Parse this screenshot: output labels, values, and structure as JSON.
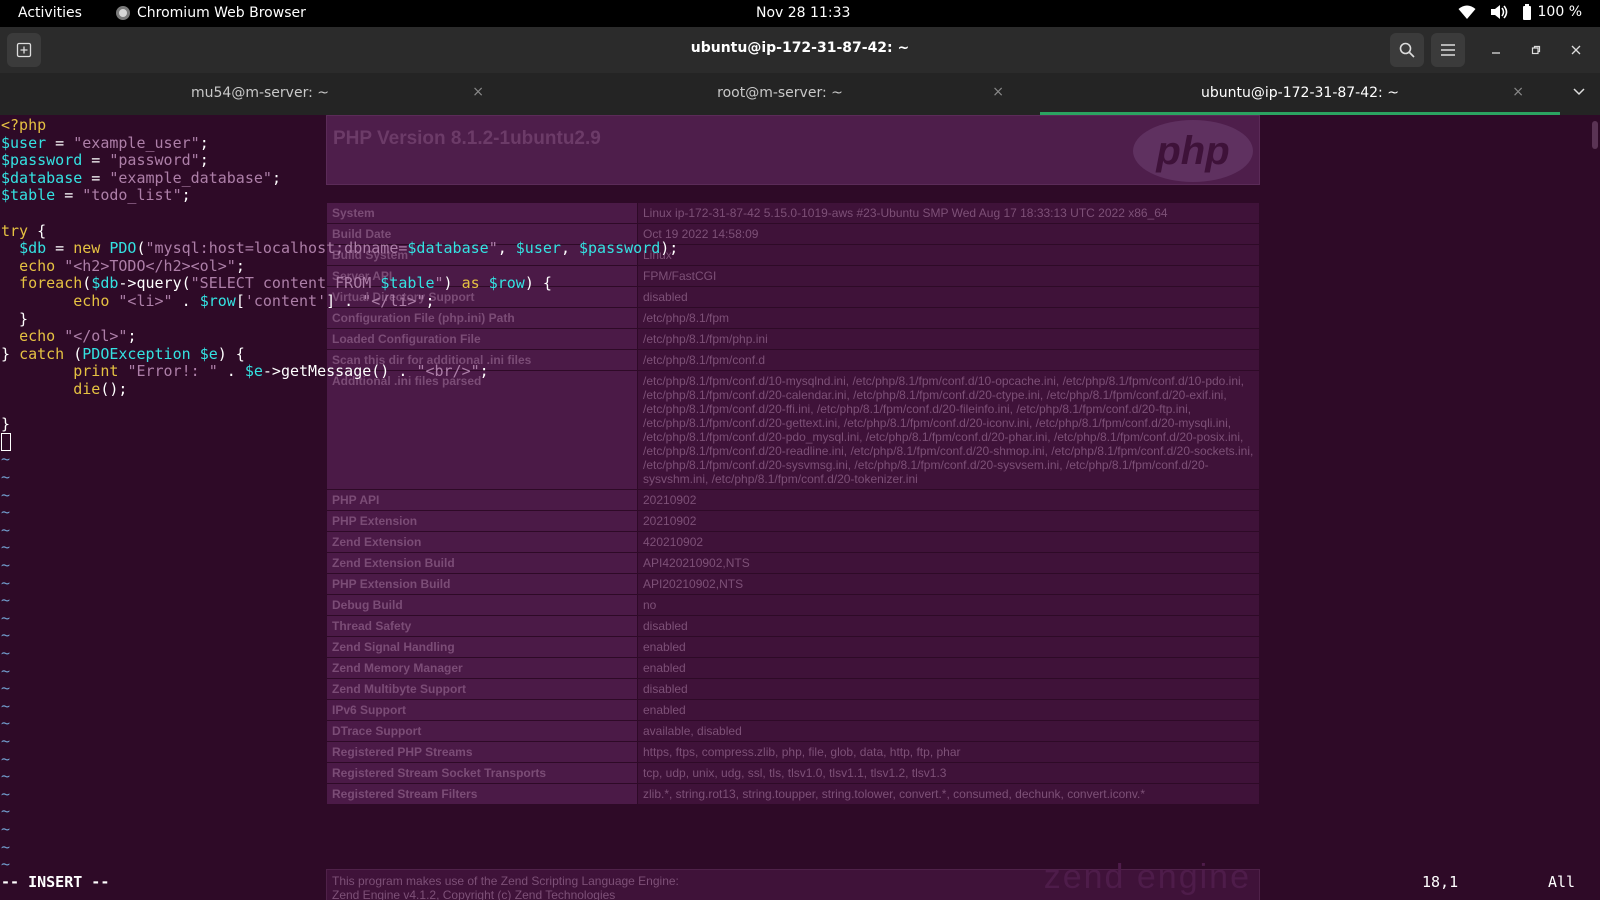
{
  "topbar": {
    "activities": "Activities",
    "app_name": "Chromium Web Browser",
    "clock": "Nov 28  11:33",
    "battery": "100 %",
    "icons": [
      "wifi-icon",
      "volume-icon",
      "battery-icon"
    ]
  },
  "window": {
    "title": "ubuntu@ip-172-31-87-42: ~"
  },
  "tabs": [
    {
      "label": "mu54@m-server: ~",
      "active": false
    },
    {
      "label": "root@m-server: ~",
      "active": false
    },
    {
      "label": "ubuntu@ip-172-31-87-42: ~",
      "active": true
    }
  ],
  "tabs_close_glyph": "×",
  "phpinfo": {
    "version": "PHP Version 8.1.2-1ubuntu2.9",
    "logo": "php",
    "rows": [
      {
        "k": "System",
        "v": "Linux ip-172-31-87-42 5.15.0-1019-aws #23-Ubuntu SMP Wed Aug 17 18:33:13 UTC 2022 x86_64"
      },
      {
        "k": "Build Date",
        "v": "Oct 19 2022 14:58:09"
      },
      {
        "k": "Build System",
        "v": "Linux"
      },
      {
        "k": "Server API",
        "v": "FPM/FastCGI"
      },
      {
        "k": "Virtual Directory Support",
        "v": "disabled"
      },
      {
        "k": "Configuration File (php.ini) Path",
        "v": "/etc/php/8.1/fpm"
      },
      {
        "k": "Loaded Configuration File",
        "v": "/etc/php/8.1/fpm/php.ini"
      },
      {
        "k": "Scan this dir for additional .ini files",
        "v": "/etc/php/8.1/fpm/conf.d"
      },
      {
        "k": "Additional .ini files parsed",
        "v": "/etc/php/8.1/fpm/conf.d/10-mysqlnd.ini, /etc/php/8.1/fpm/conf.d/10-opcache.ini, /etc/php/8.1/fpm/conf.d/10-pdo.ini, /etc/php/8.1/fpm/conf.d/20-calendar.ini, /etc/php/8.1/fpm/conf.d/20-ctype.ini, /etc/php/8.1/fpm/conf.d/20-exif.ini, /etc/php/8.1/fpm/conf.d/20-ffi.ini, /etc/php/8.1/fpm/conf.d/20-fileinfo.ini, /etc/php/8.1/fpm/conf.d/20-ftp.ini, /etc/php/8.1/fpm/conf.d/20-gettext.ini, /etc/php/8.1/fpm/conf.d/20-iconv.ini, /etc/php/8.1/fpm/conf.d/20-mysqli.ini, /etc/php/8.1/fpm/conf.d/20-pdo_mysql.ini, /etc/php/8.1/fpm/conf.d/20-phar.ini, /etc/php/8.1/fpm/conf.d/20-posix.ini, /etc/php/8.1/fpm/conf.d/20-readline.ini, /etc/php/8.1/fpm/conf.d/20-shmop.ini, /etc/php/8.1/fpm/conf.d/20-sockets.ini, /etc/php/8.1/fpm/conf.d/20-sysvmsg.ini, /etc/php/8.1/fpm/conf.d/20-sysvsem.ini, /etc/php/8.1/fpm/conf.d/20-sysvshm.ini, /etc/php/8.1/fpm/conf.d/20-tokenizer.ini"
      },
      {
        "k": "PHP API",
        "v": "20210902"
      },
      {
        "k": "PHP Extension",
        "v": "20210902"
      },
      {
        "k": "Zend Extension",
        "v": "420210902"
      },
      {
        "k": "Zend Extension Build",
        "v": "API420210902,NTS"
      },
      {
        "k": "PHP Extension Build",
        "v": "API20210902,NTS"
      },
      {
        "k": "Debug Build",
        "v": "no"
      },
      {
        "k": "Thread Safety",
        "v": "disabled"
      },
      {
        "k": "Zend Signal Handling",
        "v": "enabled"
      },
      {
        "k": "Zend Memory Manager",
        "v": "enabled"
      },
      {
        "k": "Zend Multibyte Support",
        "v": "disabled"
      },
      {
        "k": "IPv6 Support",
        "v": "enabled"
      },
      {
        "k": "DTrace Support",
        "v": "available, disabled"
      },
      {
        "k": "Registered PHP Streams",
        "v": "https, ftps, compress.zlib, php, file, glob, data, http, ftp, phar"
      },
      {
        "k": "Registered Stream Socket Transports",
        "v": "tcp, udp, unix, udg, ssl, tls, tlsv1.0, tlsv1.1, tlsv1.2, tlsv1.3"
      },
      {
        "k": "Registered Stream Filters",
        "v": "zlib.*, string.rot13, string.toupper, string.tolower, convert.*, consumed, dechunk, convert.iconv.*"
      }
    ],
    "footer_line1": "This program makes use of the Zend Scripting Language Engine:",
    "footer_line2": "Zend Engine v4.1.2, Copyright (c) Zend Technologies",
    "zend_logo": "zend engine"
  },
  "vim": {
    "code_lines": [
      [
        [
          "kw",
          "<?php"
        ]
      ],
      [
        [
          "var",
          "$user"
        ],
        [
          "fn",
          " = "
        ],
        [
          "str",
          "\"example_user\""
        ],
        [
          "fn",
          ";"
        ]
      ],
      [
        [
          "var",
          "$password"
        ],
        [
          "fn",
          " = "
        ],
        [
          "str",
          "\"password\""
        ],
        [
          "fn",
          ";"
        ]
      ],
      [
        [
          "var",
          "$database"
        ],
        [
          "fn",
          " = "
        ],
        [
          "str",
          "\"example_database\""
        ],
        [
          "fn",
          ";"
        ]
      ],
      [
        [
          "var",
          "$table"
        ],
        [
          "fn",
          " = "
        ],
        [
          "str",
          "\"todo_list\""
        ],
        [
          "fn",
          ";"
        ]
      ],
      [
        [
          "fn",
          ""
        ]
      ],
      [
        [
          "kw",
          "try"
        ],
        [
          "fn",
          " {"
        ]
      ],
      [
        [
          "fn",
          "  "
        ],
        [
          "var",
          "$db"
        ],
        [
          "fn",
          " = "
        ],
        [
          "kw",
          "new"
        ],
        [
          "fn",
          " "
        ],
        [
          "var",
          "PDO"
        ],
        [
          "fn",
          "("
        ],
        [
          "str",
          "\"mysql:host=localhost;dbname="
        ],
        [
          "var",
          "$database"
        ],
        [
          "str",
          "\""
        ],
        [
          "fn",
          ", "
        ],
        [
          "var",
          "$user"
        ],
        [
          "fn",
          ", "
        ],
        [
          "var",
          "$password"
        ],
        [
          "fn",
          ");"
        ]
      ],
      [
        [
          "fn",
          "  "
        ],
        [
          "kw",
          "echo"
        ],
        [
          "fn",
          " "
        ],
        [
          "str",
          "\"<h2>TODO</h2><ol>\""
        ],
        [
          "fn",
          ";"
        ]
      ],
      [
        [
          "fn",
          "  "
        ],
        [
          "kw",
          "foreach"
        ],
        [
          "fn",
          "("
        ],
        [
          "var",
          "$db"
        ],
        [
          "fn",
          "->query("
        ],
        [
          "str",
          "\"SELECT content FROM "
        ],
        [
          "var",
          "$table"
        ],
        [
          "str",
          "\""
        ],
        [
          "fn",
          ") "
        ],
        [
          "kw",
          "as"
        ],
        [
          "fn",
          " "
        ],
        [
          "var",
          "$row"
        ],
        [
          "fn",
          ") {"
        ]
      ],
      [
        [
          "fn",
          "        "
        ],
        [
          "kw",
          "echo"
        ],
        [
          "fn",
          " "
        ],
        [
          "str",
          "\"<li>\""
        ],
        [
          "fn",
          " . "
        ],
        [
          "var",
          "$row"
        ],
        [
          "fn",
          "["
        ],
        [
          "str",
          "'content'"
        ],
        [
          "fn",
          "] . "
        ],
        [
          "str",
          "\"</li>\""
        ],
        [
          "fn",
          ";"
        ]
      ],
      [
        [
          "fn",
          "  }"
        ]
      ],
      [
        [
          "fn",
          "  "
        ],
        [
          "kw",
          "echo"
        ],
        [
          "fn",
          " "
        ],
        [
          "str",
          "\"</ol>\""
        ],
        [
          "fn",
          ";"
        ]
      ],
      [
        [
          "fn",
          "} "
        ],
        [
          "kw",
          "catch"
        ],
        [
          "fn",
          " ("
        ],
        [
          "var",
          "PDOException"
        ],
        [
          "fn",
          " "
        ],
        [
          "var",
          "$e"
        ],
        [
          "fn",
          ") {"
        ]
      ],
      [
        [
          "fn",
          "        "
        ],
        [
          "kw",
          "print"
        ],
        [
          "fn",
          " "
        ],
        [
          "str",
          "\"Error!: \""
        ],
        [
          "fn",
          " . "
        ],
        [
          "var",
          "$e"
        ],
        [
          "fn",
          "->getMessage() . "
        ],
        [
          "str",
          "\"<br/>\""
        ],
        [
          "fn",
          ";"
        ]
      ],
      [
        [
          "fn",
          "        "
        ],
        [
          "kw",
          "die"
        ],
        [
          "fn",
          "();"
        ]
      ],
      [
        [
          "fn",
          ""
        ]
      ],
      [
        [
          "fn",
          "}"
        ]
      ]
    ],
    "tilde_glyph": "~",
    "tilde_count": 24,
    "mode": "-- INSERT --",
    "position": "18,1",
    "scroll": "All"
  },
  "colors": {
    "terminal_bg": "#2e0a27",
    "tab_active_underline": "#2ba361",
    "keyword": "#e5c142",
    "variable": "#34e2e2",
    "string": "#ad7fa8",
    "tilde": "#729fcf"
  }
}
